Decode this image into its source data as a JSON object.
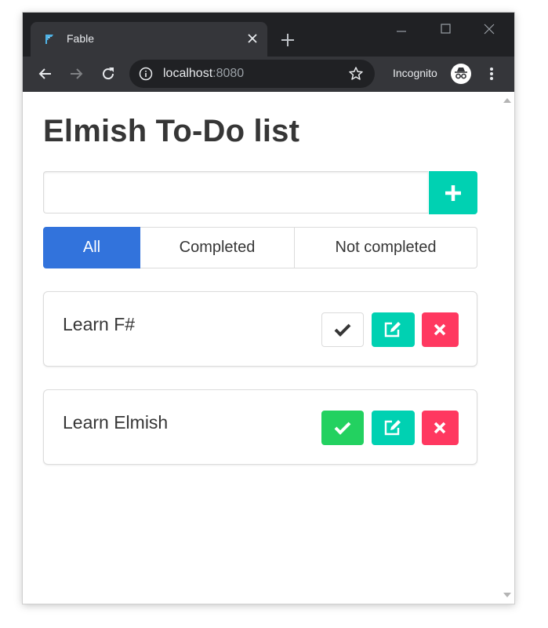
{
  "browser": {
    "tab": {
      "title": "Fable"
    },
    "omnibox": {
      "host": "localhost",
      "port": ":8080"
    },
    "incognito_label": "Incognito"
  },
  "page": {
    "title": "Elmish To-Do list",
    "input": {
      "value": "",
      "placeholder": ""
    },
    "filters": [
      {
        "label": "All",
        "active": true
      },
      {
        "label": "Completed",
        "active": false
      },
      {
        "label": "Not completed",
        "active": false
      }
    ],
    "todos": [
      {
        "text": "Learn F#",
        "completed": false
      },
      {
        "text": "Learn Elmish",
        "completed": true
      }
    ]
  },
  "icons": {
    "favicon": "fable-bird-icon",
    "add": "plus-icon",
    "toggle": "check-icon",
    "edit": "edit-icon",
    "delete": "times-icon"
  },
  "colors": {
    "primary": "#3273dc",
    "turquoise": "#00d1b2",
    "success": "#23d160",
    "danger": "#ff3860",
    "chrome_dark": "#202124",
    "chrome_toolbar": "#35363a"
  }
}
